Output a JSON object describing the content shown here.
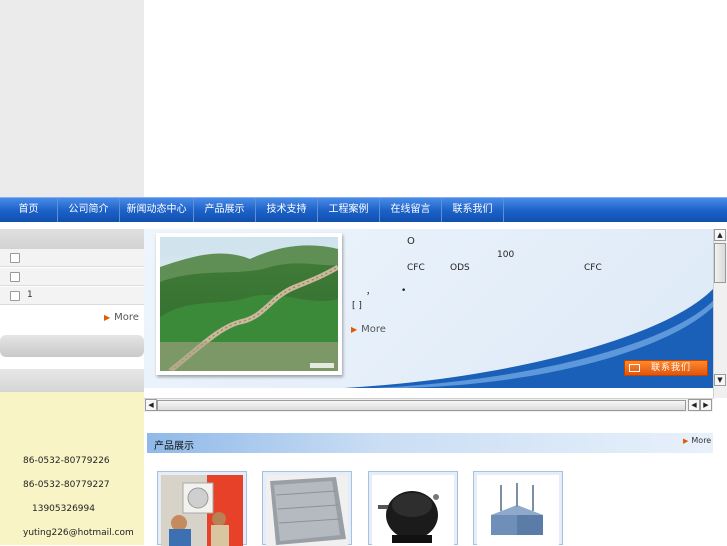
{
  "nav": {
    "items": [
      {
        "label": "首页"
      },
      {
        "label": "公司简介"
      },
      {
        "label": "新闻动态中心"
      },
      {
        "label": "产品展示"
      },
      {
        "label": "技术支持"
      },
      {
        "label": "工程案例"
      },
      {
        "label": "在线留言"
      },
      {
        "label": "联系我们"
      }
    ]
  },
  "left": {
    "rows": [
      {
        "label": ""
      },
      {
        "label": ""
      },
      {
        "label": "1"
      }
    ],
    "more_label": "More",
    "contact": {
      "phone1": "86-0532-80779226",
      "phone2": "86-0532-80779227",
      "mobile": "13905326994",
      "email": "yuting226@hotmail.com"
    }
  },
  "feature": {
    "char_o": "O",
    "num_100": "100",
    "cfc1": "CFC",
    "ods": "ODS",
    "cfc2": "CFC",
    "comma": "，",
    "dot": "•",
    "brackets": "[  ]",
    "more_label": "More",
    "contact_button": "联系我们"
  },
  "products": {
    "title": "产品展示",
    "more_label": "More"
  },
  "colors": {
    "nav_blue": "#1e63c9",
    "accent_orange": "#e2540e",
    "contact_bg": "#f8f4c6"
  }
}
